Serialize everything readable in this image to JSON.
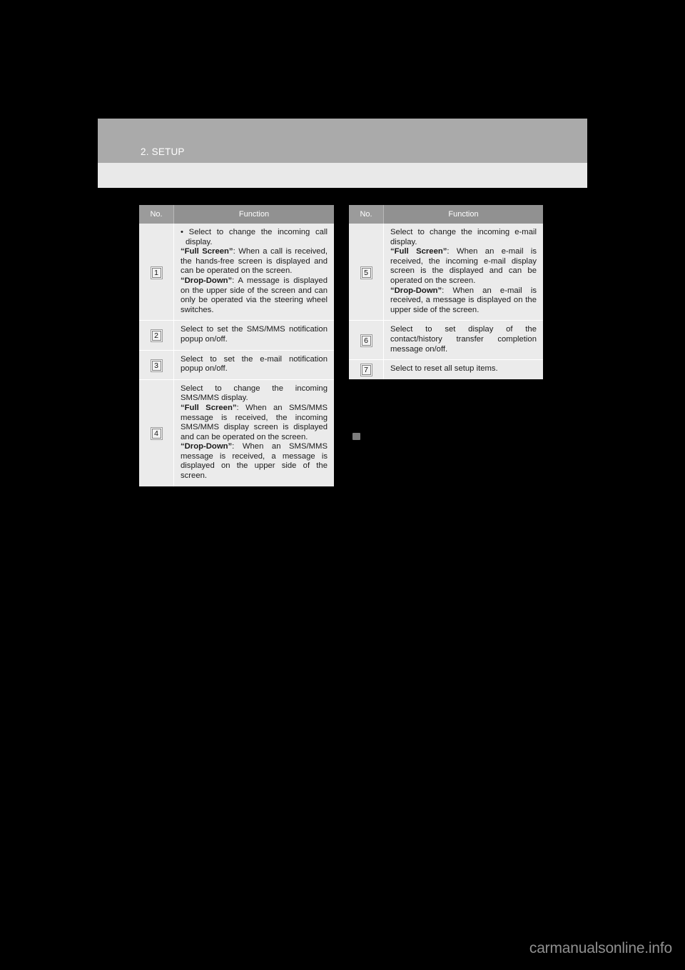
{
  "page": {
    "section_title": "2. SETUP",
    "watermark": "carmanualsonline.info"
  },
  "tables": {
    "headers": {
      "no": "No.",
      "function": "Function"
    },
    "left": {
      "rows": [
        {
          "no": "1",
          "blocks": [
            {
              "style": "bullet",
              "text": "Select to change the incoming call display."
            },
            {
              "style": "quoted",
              "quote": "“Full Screen”",
              "text": ": When a call is received, the hands-free screen is displayed and can be operated on the screen."
            },
            {
              "style": "quoted",
              "quote": "“Drop-Down”",
              "text": ": A message is displayed on the upper side of the screen and can only be operated via the steering wheel switches."
            }
          ]
        },
        {
          "no": "2",
          "blocks": [
            {
              "style": "plain",
              "text": "Select to set the SMS/MMS notification popup on/off."
            }
          ]
        },
        {
          "no": "3",
          "blocks": [
            {
              "style": "plain",
              "text": "Select to set the e-mail notification popup on/off."
            }
          ]
        },
        {
          "no": "4",
          "blocks": [
            {
              "style": "plain",
              "text": "Select to change the incoming SMS/MMS display."
            },
            {
              "style": "quoted",
              "quote": "“Full Screen”",
              "text": ": When an SMS/MMS message is received, the incoming SMS/MMS display screen is displayed and can be operated on the screen."
            },
            {
              "style": "quoted",
              "quote": "“Drop-Down”",
              "text": ": When an SMS/MMS message is received, a message is displayed on the upper side of the screen."
            }
          ]
        }
      ]
    },
    "right": {
      "rows": [
        {
          "no": "5",
          "blocks": [
            {
              "style": "plain",
              "text": "Select to change the incoming e-mail display."
            },
            {
              "style": "quoted",
              "quote": "“Full Screen”",
              "text": ": When an e-mail is received, the incoming e-mail display screen is the displayed and can be operated on the screen."
            },
            {
              "style": "quoted",
              "quote": "“Drop-Down”",
              "text": ": When an e-mail is received, a message is displayed on the upper side of the screen."
            }
          ]
        },
        {
          "no": "6",
          "blocks": [
            {
              "style": "plain",
              "text": "Select to set display of the contact/history transfer completion message on/off."
            }
          ]
        },
        {
          "no": "7",
          "blocks": [
            {
              "style": "plain",
              "text": "Select to reset all setup items."
            }
          ]
        }
      ]
    }
  }
}
